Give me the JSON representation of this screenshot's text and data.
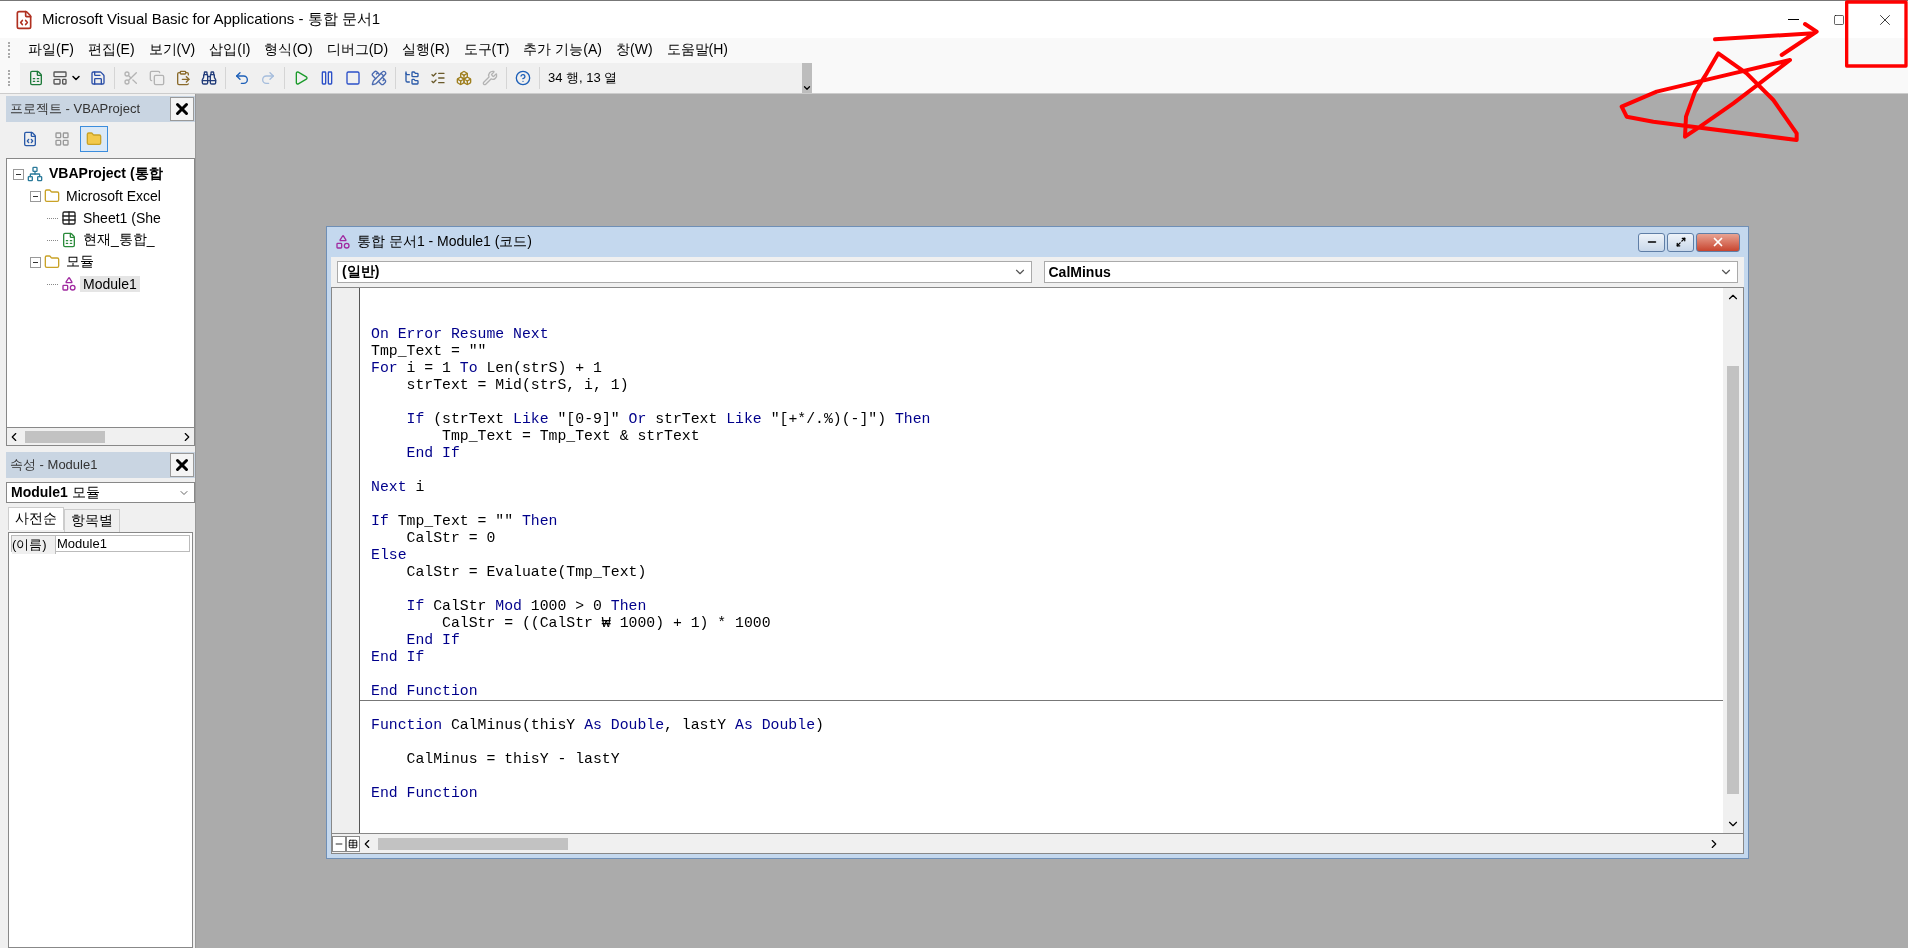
{
  "window": {
    "title": "Microsoft Visual Basic for Applications - 통합 문서1"
  },
  "menu": [
    "파일(F)",
    "편집(E)",
    "보기(V)",
    "삽입(I)",
    "형식(O)",
    "디버그(D)",
    "실행(R)",
    "도구(T)",
    "추가 기능(A)",
    "창(W)",
    "도움말(H)"
  ],
  "toolbar_groups": [
    [
      {
        "kind": "excel",
        "disabled": false
      },
      {
        "kind": "userform",
        "disabled": false
      },
      {
        "kind": "save",
        "disabled": false
      }
    ],
    [
      {
        "kind": "cut",
        "disabled": true
      },
      {
        "kind": "copy",
        "disabled": true
      },
      {
        "kind": "paste",
        "disabled": false
      },
      {
        "kind": "find",
        "disabled": false
      }
    ],
    [
      {
        "kind": "undo",
        "disabled": false
      },
      {
        "kind": "redo",
        "disabled": true
      }
    ],
    [
      {
        "kind": "run",
        "disabled": false
      },
      {
        "kind": "pause",
        "disabled": false
      },
      {
        "kind": "stop",
        "disabled": false
      },
      {
        "kind": "design",
        "disabled": false
      }
    ],
    [
      {
        "kind": "explorer",
        "disabled": false
      },
      {
        "kind": "properties",
        "disabled": false
      },
      {
        "kind": "browser",
        "disabled": false
      },
      {
        "kind": "toolbox",
        "disabled": true
      }
    ],
    [
      {
        "kind": "help",
        "disabled": false
      }
    ]
  ],
  "cursor_position": "34 행, 13 열",
  "project_panel": {
    "title": "프로젝트 - VBAProject",
    "view_buttons": [
      {
        "kind": "code",
        "selected": false
      },
      {
        "kind": "object",
        "selected": false
      },
      {
        "kind": "folders",
        "selected": true
      }
    ],
    "tree": [
      {
        "label": "VBAProject (통합",
        "kind": "project",
        "expanded": true,
        "selected": false,
        "children": [
          {
            "label": "Microsoft Excel",
            "kind": "folder",
            "expanded": true,
            "selected": false,
            "children": [
              {
                "label": "Sheet1 (She",
                "kind": "sheet",
                "selected": false
              },
              {
                "label": "현재_통합_",
                "kind": "workbook",
                "selected": false
              }
            ]
          },
          {
            "label": "모듈",
            "kind": "folder",
            "expanded": true,
            "selected": false,
            "children": [
              {
                "label": "Module1",
                "kind": "module",
                "selected": true
              }
            ]
          }
        ]
      }
    ]
  },
  "properties_panel": {
    "title": "속성 - Module1",
    "object": "**Module1** 모듈",
    "tabs": [
      {
        "label": "사전순",
        "selected": true
      },
      {
        "label": "항목별",
        "selected": false
      }
    ],
    "rows": [
      {
        "name": "(이름)",
        "value": "Module1"
      }
    ]
  },
  "code_window": {
    "title": "통합 문서1 - Module1 (코드)",
    "object": "(일반)",
    "procedure": "CalMinus",
    "lines": [
      {
        "kind": "blank"
      },
      {
        "kind": "blank"
      },
      {
        "kind": "code",
        "segments": [
          {
            "text": "On Error Resume Next",
            "keyword": true
          }
        ]
      },
      {
        "kind": "code",
        "segments": [
          {
            "text": "Tmp_Text = \"\"",
            "keyword": false
          }
        ]
      },
      {
        "kind": "code",
        "segments": [
          {
            "text": "For",
            "keyword": true
          },
          {
            "text": " i = 1 ",
            "keyword": false
          },
          {
            "text": "To",
            "keyword": true
          },
          {
            "text": " Len(strS) + 1",
            "keyword": false
          }
        ]
      },
      {
        "kind": "code",
        "segments": [
          {
            "text": "    strText = Mid(strS, i, 1)",
            "keyword": false
          }
        ]
      },
      {
        "kind": "blank"
      },
      {
        "kind": "code",
        "segments": [
          {
            "text": "    If",
            "keyword": true
          },
          {
            "text": " (strText ",
            "keyword": false
          },
          {
            "text": "Like",
            "keyword": true
          },
          {
            "text": " \"[0-9]\" ",
            "keyword": false
          },
          {
            "text": "Or",
            "keyword": true
          },
          {
            "text": " strText ",
            "keyword": false
          },
          {
            "text": "Like",
            "keyword": true
          },
          {
            "text": " \"[+*/.%)(-]\") ",
            "keyword": false
          },
          {
            "text": "Then",
            "keyword": true
          }
        ]
      },
      {
        "kind": "code",
        "segments": [
          {
            "text": "        Tmp_Text = Tmp_Text & strText",
            "keyword": false
          }
        ]
      },
      {
        "kind": "code",
        "segments": [
          {
            "text": "    End If",
            "keyword": true
          }
        ]
      },
      {
        "kind": "blank"
      },
      {
        "kind": "code",
        "segments": [
          {
            "text": "Next",
            "keyword": true
          },
          {
            "text": " i",
            "keyword": false
          }
        ]
      },
      {
        "kind": "blank"
      },
      {
        "kind": "code",
        "segments": [
          {
            "text": "If",
            "keyword": true
          },
          {
            "text": " Tmp_Text = \"\" ",
            "keyword": false
          },
          {
            "text": "Then",
            "keyword": true
          }
        ]
      },
      {
        "kind": "code",
        "segments": [
          {
            "text": "    CalStr = 0",
            "keyword": false
          }
        ]
      },
      {
        "kind": "code",
        "segments": [
          {
            "text": "Else",
            "keyword": true
          }
        ]
      },
      {
        "kind": "code",
        "segments": [
          {
            "text": "    CalStr = Evaluate(Tmp_Text)",
            "keyword": false
          }
        ]
      },
      {
        "kind": "blank"
      },
      {
        "kind": "code",
        "segments": [
          {
            "text": "    If",
            "keyword": true
          },
          {
            "text": " CalStr ",
            "keyword": false
          },
          {
            "text": "Mod",
            "keyword": true
          },
          {
            "text": " 1000 > 0 ",
            "keyword": false
          },
          {
            "text": "Then",
            "keyword": true
          }
        ]
      },
      {
        "kind": "code",
        "segments": [
          {
            "text": "        CalStr = ((CalStr ₩ 1000) + 1) * 1000",
            "keyword": false
          }
        ]
      },
      {
        "kind": "code",
        "segments": [
          {
            "text": "    End If",
            "keyword": true
          }
        ]
      },
      {
        "kind": "code",
        "segments": [
          {
            "text": "End If",
            "keyword": true
          }
        ]
      },
      {
        "kind": "blank"
      },
      {
        "kind": "code",
        "segments": [
          {
            "text": "End Function",
            "keyword": true
          }
        ]
      },
      {
        "kind": "divider"
      },
      {
        "kind": "code",
        "segments": [
          {
            "text": "Function",
            "keyword": true
          },
          {
            "text": " CalMinus(thisY ",
            "keyword": false
          },
          {
            "text": "As Double",
            "keyword": true
          },
          {
            "text": ", lastY ",
            "keyword": false
          },
          {
            "text": "As Double",
            "keyword": true
          },
          {
            "text": ")",
            "keyword": false
          }
        ]
      },
      {
        "kind": "blank"
      },
      {
        "kind": "code",
        "segments": [
          {
            "text": "    CalMinus = thisY - lastY",
            "keyword": false
          }
        ]
      },
      {
        "kind": "blank"
      },
      {
        "kind": "code",
        "segments": [
          {
            "text": "End Function",
            "keyword": true
          }
        ]
      }
    ]
  }
}
